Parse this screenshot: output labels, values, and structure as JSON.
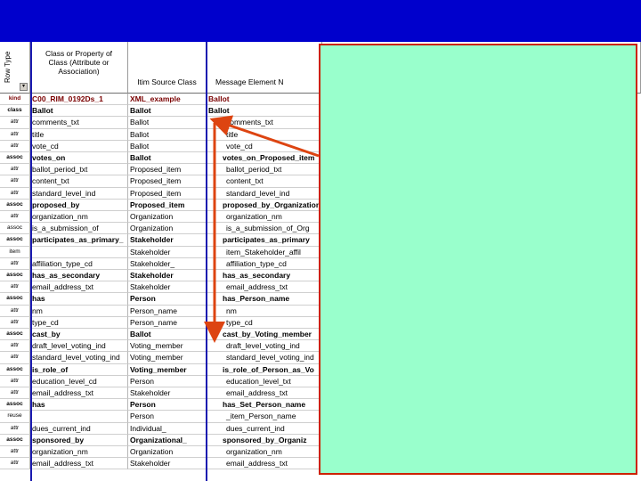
{
  "header": {
    "row_type": "Row Type",
    "class_or_property": "Class or Property of Class (Attribute or Association)",
    "itim_source_class": "Itim Source Class",
    "message_element": "Message Element N",
    "dropdown_glyph": "▾"
  },
  "rows": [
    {
      "type": "kind",
      "name": "C00_RIM_0192Ds_1",
      "source": "XML_example",
      "element": "Ballot",
      "bold": true
    },
    {
      "type": "class",
      "name": "Ballot",
      "source": "Ballot",
      "element": "Ballot",
      "bold": true
    },
    {
      "type": "attr",
      "name": "comments_txt",
      "source": "Ballot",
      "element": "comments_txt",
      "bold": false
    },
    {
      "type": "attr",
      "name": "title",
      "source": "Ballot",
      "element": "title",
      "bold": false
    },
    {
      "type": "attr",
      "name": "vote_cd",
      "source": "Ballot",
      "element": "vote_cd",
      "bold": false
    },
    {
      "type": "assoc",
      "name": "votes_on",
      "source": "Ballot",
      "element": "votes_on_Proposed_item",
      "bold": true
    },
    {
      "type": "attr",
      "name": "ballot_period_txt",
      "source": "Proposed_item",
      "element": "ballot_period_txt",
      "bold": false
    },
    {
      "type": "attr",
      "name": "content_txt",
      "source": "Proposed_item",
      "element": "content_txt",
      "bold": false
    },
    {
      "type": "attr",
      "name": "standard_level_ind",
      "source": "Proposed_item",
      "element": "standard_level_ind",
      "bold": false
    },
    {
      "type": "assoc",
      "name": "proposed_by",
      "source": "Proposed_item",
      "element": "proposed_by_Organization",
      "bold": true
    },
    {
      "type": "attr",
      "name": "organization_nm",
      "source": "Organization",
      "element": "organization_nm",
      "bold": false
    },
    {
      "type": "assoc",
      "name": "is_a_submission_of",
      "source": "Organization",
      "element": "is_a_submission_of_Org",
      "bold": false
    },
    {
      "type": "assoc",
      "name": "participates_as_primary_",
      "source": "Stakeholder",
      "element": "participates_as_primary",
      "bold": true
    },
    {
      "type": "item",
      "name": "",
      "source": "Stakeholder",
      "element": "item_Stakeholder_affil",
      "bold": false
    },
    {
      "type": "attr",
      "name": "affiliation_type_cd",
      "source": "Stakeholder_",
      "element": "affiliation_type_cd",
      "bold": false
    },
    {
      "type": "assoc",
      "name": "has_as_secondary",
      "source": "Stakeholder",
      "element": "has_as_secondary",
      "bold": true
    },
    {
      "type": "attr",
      "name": "email_address_txt",
      "source": "Stakeholder",
      "element": "email_address_txt",
      "bold": false
    },
    {
      "type": "assoc",
      "name": "has",
      "source": "Person",
      "element": "has_Person_name",
      "bold": true
    },
    {
      "type": "attr",
      "name": "nm",
      "source": "Person_name",
      "element": "nm",
      "bold": false
    },
    {
      "type": "attr",
      "name": "type_cd",
      "source": "Person_name",
      "element": "type_cd",
      "bold": false
    },
    {
      "type": "assoc",
      "name": "cast_by",
      "source": "Ballot",
      "element": "cast_by_Voting_member",
      "bold": true
    },
    {
      "type": "attr",
      "name": "draft_level_voting_ind",
      "source": "Voting_member",
      "element": "draft_level_voting_ind",
      "bold": false
    },
    {
      "type": "attr",
      "name": "standard_level_voting_ind",
      "source": "Voting_member",
      "element": "standard_level_voting_ind",
      "bold": false
    },
    {
      "type": "assoc",
      "name": "is_role_of",
      "source": "Voting_member",
      "element": "is_role_of_Person_as_Vo",
      "bold": true
    },
    {
      "type": "attr",
      "name": "education_level_cd",
      "source": "Person",
      "element": "education_level_txt",
      "bold": false
    },
    {
      "type": "attr",
      "name": "email_address_txt",
      "source": "Stakeholder",
      "element": "email_address_txt",
      "bold": false
    },
    {
      "type": "assoc",
      "name": "has",
      "source": "Person",
      "element": "has_Set_Person_name",
      "bold": true
    },
    {
      "type": "reuse",
      "name": "",
      "source": "Person",
      "element": "_item_Person_name",
      "bold": false
    },
    {
      "type": "attr",
      "name": "dues_current_ind",
      "source": "Individual_",
      "element": "dues_current_ind",
      "bold": false
    },
    {
      "type": "assoc",
      "name": "sponsored_by",
      "source": "Organizational_",
      "element": "sponsored_by_Organiz",
      "bold": true
    },
    {
      "type": "attr",
      "name": "organization_nm",
      "source": "Organization",
      "element": "organization_nm",
      "bold": false
    },
    {
      "type": "attr",
      "name": "email_address_txt",
      "source": "Stakeholder",
      "element": "email_address_txt",
      "bold": false
    }
  ],
  "colors": {
    "title_bar": "#0000cc",
    "overlay": "#99ffcc",
    "arrow": "#dd4411",
    "column_divider": "#1a1ab0"
  }
}
